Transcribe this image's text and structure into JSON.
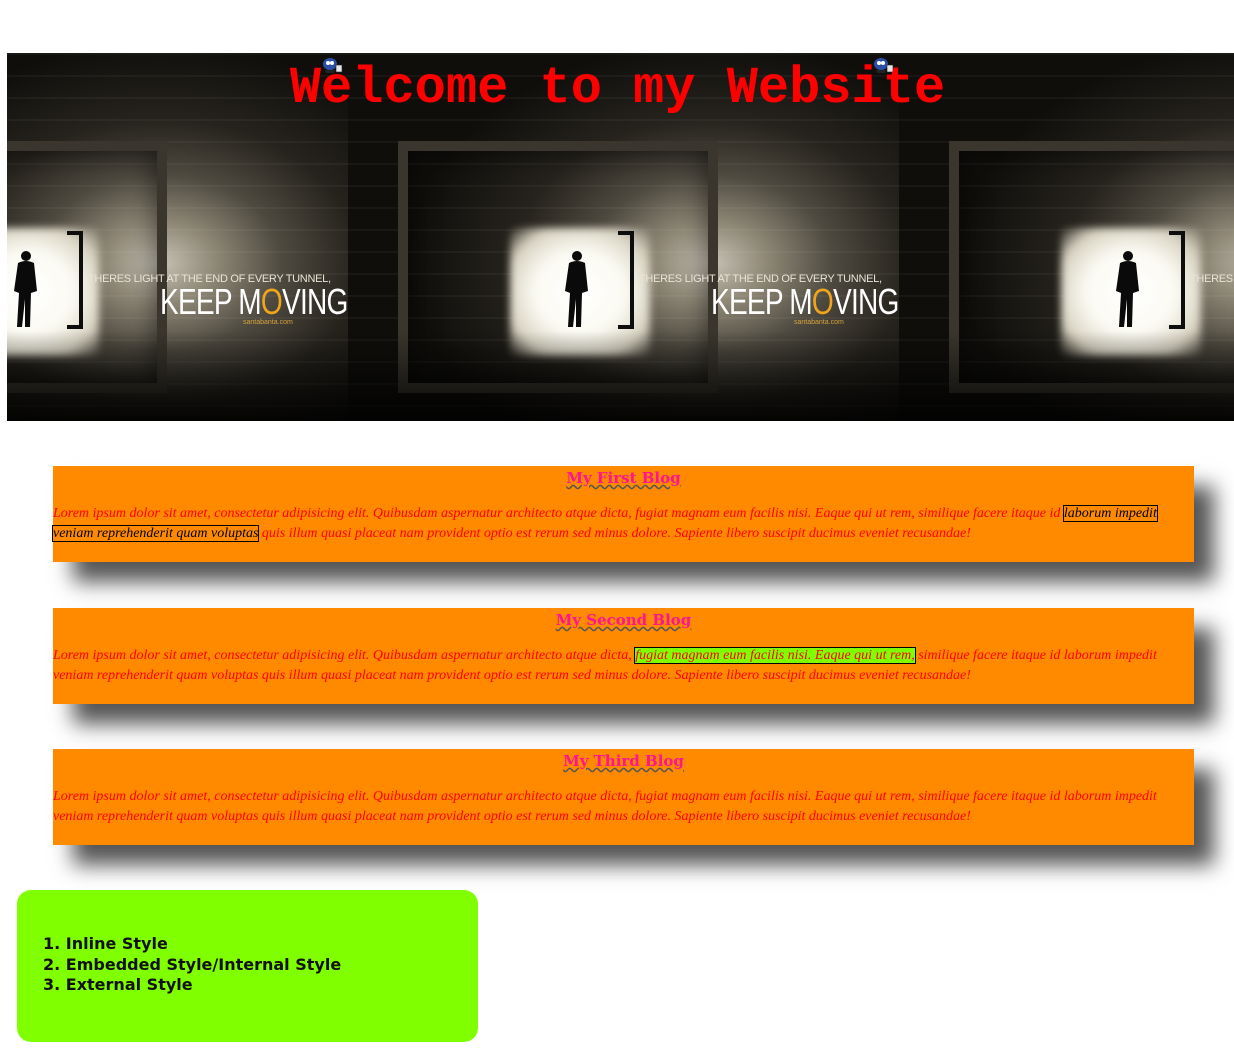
{
  "banner": {
    "title": "Welcome to my Website",
    "tagline_small": "THERES LIGHT AT THE END OF EVERY TUNNEL,",
    "tagline_big_part1": "KEEP M",
    "tagline_big_o": "O",
    "tagline_big_part2": "VING.",
    "tagline_url": "santabanta.com",
    "tagline_small_cut": "THERES LIG",
    "icon": "cartoon-character-icon"
  },
  "blogs": [
    {
      "title": "My First Blog",
      "text_before": "Lorem ipsum dolor sit amet, consectetur adipisicing elit. Quibusdam aspernatur architecto atque dicta, fugiat magnam eum facilis nisi. Eaque qui ut rem, similique facere itaque id ",
      "highlight": "laborum impedit veniam reprehenderit quam voluptas",
      "text_after": " quis illum quasi placeat nam provident optio est rerum sed minus dolore. Sapiente libero suscipit ducimus eveniet recusandae!"
    },
    {
      "title": "My Second Blog",
      "text_before": "Lorem ipsum dolor sit amet, consectetur adipisicing elit. Quibusdam aspernatur architecto atque dicta, ",
      "highlight": "fugiat magnam eum facilis nisi. Eaque qui ut rem,",
      "text_after": " similique facere itaque id laborum impedit veniam reprehenderit quam voluptas quis illum quasi placeat nam provident optio est rerum sed minus dolore. Sapiente libero suscipit ducimus eveniet recusandae!"
    },
    {
      "title": "My Third Blog",
      "text": "Lorem ipsum dolor sit amet, consectetur adipisicing elit. Quibusdam aspernatur architecto atque dicta, fugiat magnam eum facilis nisi. Eaque qui ut rem, similique facere itaque id laborum impedit veniam reprehenderit quam voluptas quis illum quasi placeat nam provident optio est rerum sed minus dolore. Sapiente libero suscipit ducimus eveniet recusandae!"
    }
  ],
  "style_types": {
    "items": [
      "1. Inline Style",
      "2. Embedded Style/Internal Style",
      "3. External Style"
    ]
  },
  "colors": {
    "title_red": "#ff0000",
    "blog_bg": "#ff8a00",
    "blog_title": "#ff1493",
    "highlight_green": "#7fff00",
    "list_box_bg": "#7fff00"
  }
}
